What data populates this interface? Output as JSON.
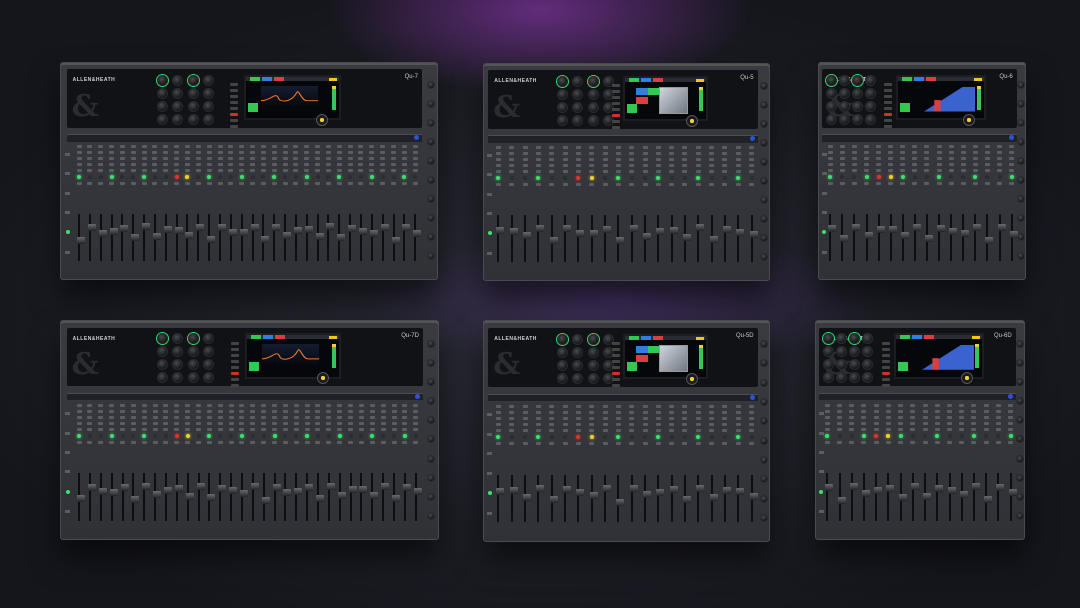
{
  "brand": "ALLEN&HEATH",
  "consoles": [
    {
      "id": "mixer-a",
      "model": "Qu-7",
      "size": "large",
      "screen": "eq"
    },
    {
      "id": "mixer-b",
      "model": "Qu-5",
      "size": "medium",
      "screen": "plugin"
    },
    {
      "id": "mixer-c",
      "model": "Qu-6",
      "size": "small",
      "screen": "meters"
    },
    {
      "id": "mixer-d",
      "model": "Qu-7D",
      "size": "large",
      "screen": "eq"
    },
    {
      "id": "mixer-e",
      "model": "Qu-5D",
      "size": "medium",
      "screen": "plugin"
    },
    {
      "id": "mixer-f",
      "model": "Qu-6D",
      "size": "small",
      "screen": "meters"
    }
  ],
  "colors": {
    "background": "#1b1c24",
    "glow": "#a03cc8",
    "console_body": "#34353a",
    "led_green": "#3ee06a",
    "led_yellow": "#f0d02c",
    "led_red": "#e0332b",
    "select_blue": "#2d52d8"
  },
  "icons": [
    "ampersand-logo-icon",
    "rotary-knob-icon",
    "fader-icon",
    "led-indicator-icon"
  ]
}
